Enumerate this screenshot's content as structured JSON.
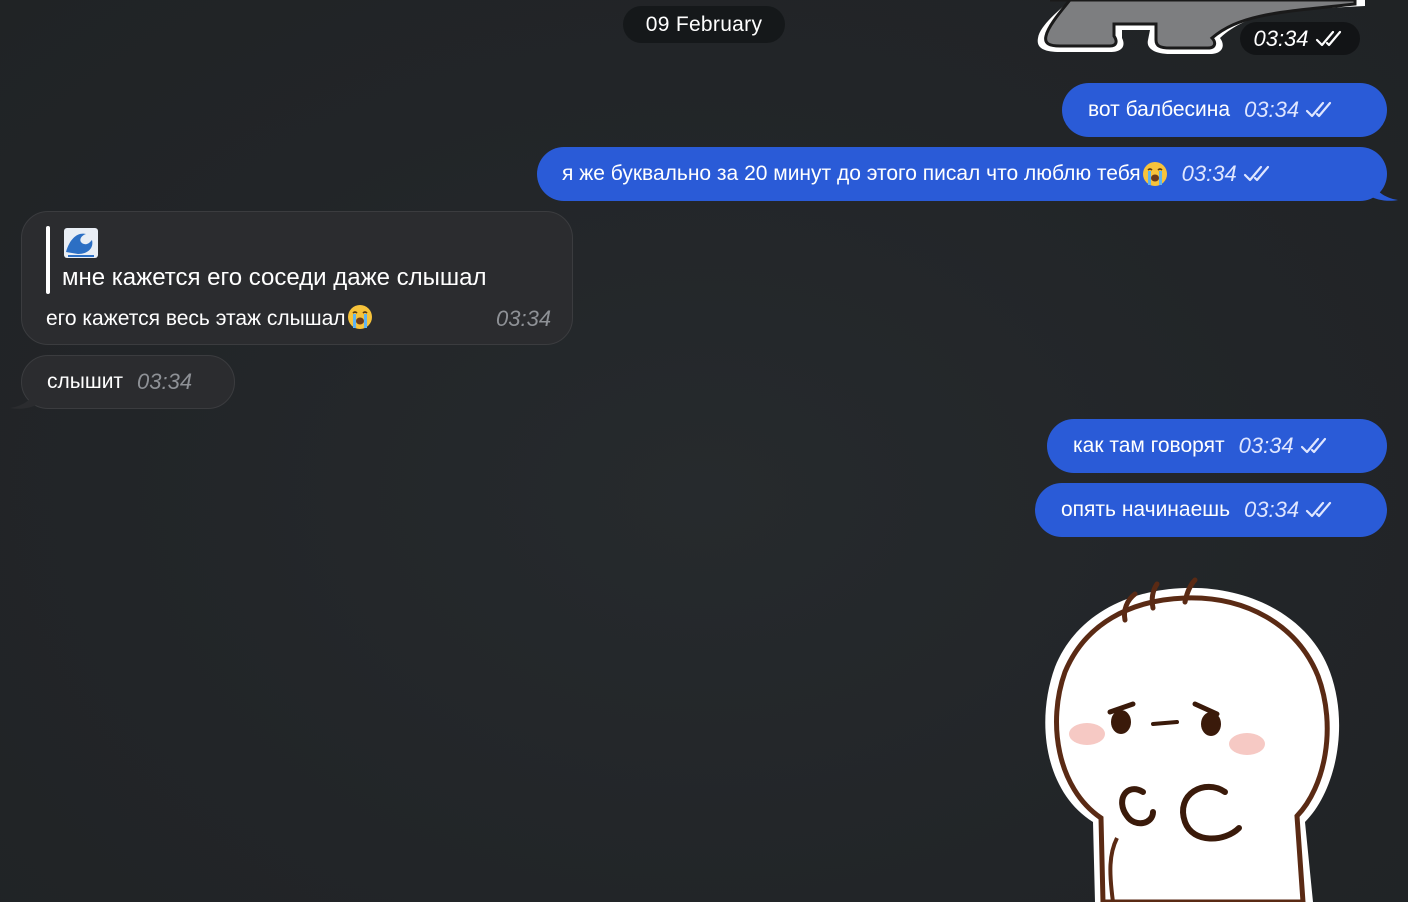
{
  "chat": {
    "date_label": "09 February",
    "sticker_top_time": "03:34",
    "messages": [
      {
        "id": "m1",
        "direction": "outgoing",
        "text": "вот балбесина",
        "time": "03:34",
        "status": "read"
      },
      {
        "id": "m2",
        "direction": "outgoing",
        "text": "я же буквально за 20 минут до этого писал что люблю тебя",
        "emoji": "loudly-crying-face",
        "time": "03:34",
        "status": "read"
      },
      {
        "id": "m3",
        "direction": "incoming",
        "reply": {
          "emoji": "water-wave",
          "text": "мне кажется его соседи даже слышал"
        },
        "text": "его кажется весь этаж слышал",
        "emoji": "loudly-crying-face",
        "time": "03:34"
      },
      {
        "id": "m4",
        "direction": "incoming",
        "text": "слышит",
        "time": "03:34"
      },
      {
        "id": "m5",
        "direction": "outgoing",
        "text": "как там говорят",
        "time": "03:34",
        "status": "read"
      },
      {
        "id": "m6",
        "direction": "outgoing",
        "text": "опять начинаешь",
        "time": "03:34",
        "status": "read"
      }
    ]
  },
  "colors": {
    "background": "#232629",
    "outgoing_bubble": "#2a5bd7",
    "incoming_bubble": "#2b2c2f",
    "date_pill": "#15181a"
  },
  "icons": {
    "read_status": "double-check-icon",
    "top_sticker": "gray-animal-sticker",
    "bottom_sticker": "white-blob-character-sticker"
  }
}
